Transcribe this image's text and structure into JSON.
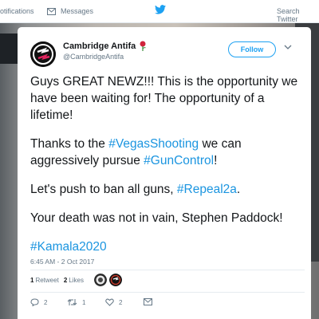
{
  "nav": {
    "notifications_label": "otifications",
    "messages_label": "Messages",
    "search_label": "Search Twitter"
  },
  "tweet": {
    "author_name": "Cambridge Antifa",
    "author_handle": "@CambridgeAntifa",
    "follow_label": "Follow",
    "p1": "Guys GREAT NEWZ!!! This is the opportunity we have been waiting for! The opportunity of a lifetime!",
    "p2_a": "Thanks to the ",
    "p2_link1": "#VegasShooting",
    "p2_b": " we can aggressively pursue ",
    "p2_link2": "#GunControl",
    "p2_c": "!",
    "p3_a": "Let's push to ban all guns, ",
    "p3_link": "#Repeal2a",
    "p3_b": ".",
    "p4": "Your death was not in vain, Stephen Paddock!",
    "p5_link": "#Kamala2020",
    "timestamp": "6:45 AM - 2 Oct 2017",
    "retweet_count": "1",
    "retweet_label": "Retweet",
    "like_count": "2",
    "like_label": "Likes",
    "reply_count": "2",
    "retweet_action_count": "1",
    "like_action_count": "2"
  },
  "colors": {
    "link": "#1b95e0",
    "twitter_blue": "#1da1f2",
    "muted": "#657786"
  }
}
